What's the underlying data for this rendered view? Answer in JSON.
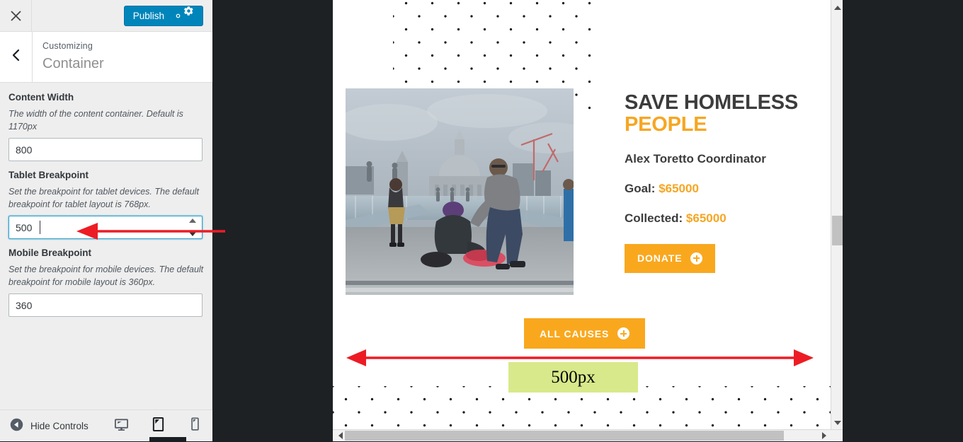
{
  "customizer": {
    "close_icon": "close-x-icon",
    "publish_label": "Publish",
    "publish_gear_icon": "gear-icon",
    "back_icon": "chevron-left-icon",
    "breadcrumb_label": "Customizing",
    "panel_title": "Container",
    "accent_color": "#0085ba",
    "controls": [
      {
        "label": "Content Width",
        "description": "The width of the content container. Default is 1170px",
        "value": "800",
        "focused": false,
        "has_spinner": false
      },
      {
        "label": "Tablet Breakpoint",
        "description": "Set the breakpoint for tablet devices. The default breakpoint for tablet layout is 768px.",
        "value": "500",
        "focused": true,
        "has_spinner": true
      },
      {
        "label": "Mobile Breakpoint",
        "description": "Set the breakpoint for mobile devices. The default breakpoint for mobile layout is 360px.",
        "value": "360",
        "focused": false,
        "has_spinner": false
      }
    ],
    "footer": {
      "hide_controls_label": "Hide Controls",
      "hide_controls_icon": "collapse-left-arrow-icon",
      "devices": [
        {
          "name": "desktop",
          "icon": "desktop-icon",
          "active": false
        },
        {
          "name": "tablet",
          "icon": "tablet-icon",
          "active": true
        },
        {
          "name": "mobile",
          "icon": "mobile-icon",
          "active": false
        }
      ]
    }
  },
  "preview": {
    "hero": {
      "title_line1": "SAVE HOMELESS",
      "title_line2": "PEOPLE",
      "title_accent_color": "#F6A623",
      "coordinator": "Alex Toretto Coordinator",
      "goal_label": "Goal:",
      "goal_amount": "$65000",
      "collected_label": "Collected:",
      "collected_amount": "$65000",
      "donate_label": "DONATE",
      "donate_icon": "plus-circle-icon",
      "button_color": "#F9A81E"
    },
    "all_causes_label": "ALL CAUSES",
    "all_causes_icon": "plus-circle-icon",
    "image_alt": "photo-street-scene-st-pauls-cathedral"
  },
  "annotation": {
    "width_label": "500px",
    "arrow_color": "#ED1C24",
    "highlight_color": "#d8e98b"
  }
}
